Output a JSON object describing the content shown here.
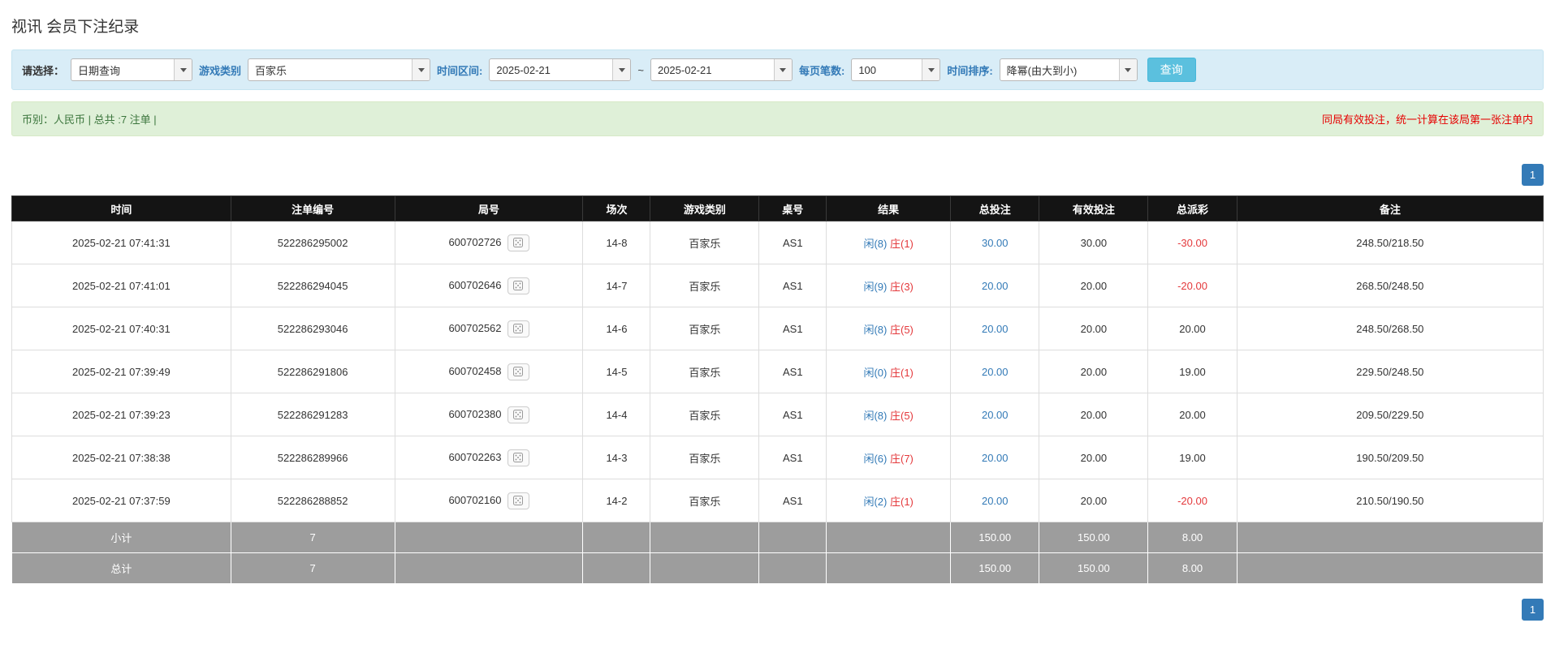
{
  "page": {
    "title": "视讯 会员下注纪录"
  },
  "filter_bar": {
    "select_label": "请选择：",
    "select_value": "日期查询",
    "game_label": "游戏类别",
    "game_value": "百家乐",
    "range_label": "时间区间:",
    "date_from": "2025-02-21",
    "range_separator": "~",
    "date_to": "2025-02-21",
    "page_size_label": "每页笔数:",
    "page_size_value": "100",
    "sort_label": "时间排序:",
    "sort_value": "降幂(由大到小)",
    "search_button": "查询"
  },
  "summary_bar": {
    "left_text": "币别：人民币 | 总共 :7 注单 |",
    "right_notice": "同局有效投注，统一计算在该局第一张注单内"
  },
  "pagination": {
    "current_page": "1"
  },
  "colors": {
    "accent_blue": "#337ab7",
    "search_button_blue": "#5bc0de",
    "filter_bar_bg": "#d9edf7",
    "summary_bar_bg": "#dff0d8",
    "header_bg": "#141414",
    "footer_bg": "#9d9d9d",
    "player_blue": "#337ab7",
    "banker_red": "#e4393c",
    "negative_red": "#e4393c",
    "notice_red": "#e60000"
  },
  "table": {
    "headers": [
      "时间",
      "注单编号",
      "局号",
      "场次",
      "游戏类别",
      "桌号",
      "结果",
      "总投注",
      "有效投注",
      "总派彩",
      "备注"
    ],
    "rows": [
      {
        "time": "2025-02-21 07:41:31",
        "bet_id": "522286295002",
        "round_id": "600702726",
        "session": "14-8",
        "game_type": "百家乐",
        "table_no": "AS1",
        "result_player": "闲(8)",
        "result_banker": "庄(1)",
        "total_bet": "30.00",
        "valid_bet": "30.00",
        "payout": "-30.00",
        "note": "248.50/218.50"
      },
      {
        "time": "2025-02-21 07:41:01",
        "bet_id": "522286294045",
        "round_id": "600702646",
        "session": "14-7",
        "game_type": "百家乐",
        "table_no": "AS1",
        "result_player": "闲(9)",
        "result_banker": "庄(3)",
        "total_bet": "20.00",
        "valid_bet": "20.00",
        "payout": "-20.00",
        "note": "268.50/248.50"
      },
      {
        "time": "2025-02-21 07:40:31",
        "bet_id": "522286293046",
        "round_id": "600702562",
        "session": "14-6",
        "game_type": "百家乐",
        "table_no": "AS1",
        "result_player": "闲(8)",
        "result_banker": "庄(5)",
        "total_bet": "20.00",
        "valid_bet": "20.00",
        "payout": "20.00",
        "note": "248.50/268.50"
      },
      {
        "time": "2025-02-21 07:39:49",
        "bet_id": "522286291806",
        "round_id": "600702458",
        "session": "14-5",
        "game_type": "百家乐",
        "table_no": "AS1",
        "result_player": "闲(0)",
        "result_banker": "庄(1)",
        "total_bet": "20.00",
        "valid_bet": "20.00",
        "payout": "19.00",
        "note": "229.50/248.50"
      },
      {
        "time": "2025-02-21 07:39:23",
        "bet_id": "522286291283",
        "round_id": "600702380",
        "session": "14-4",
        "game_type": "百家乐",
        "table_no": "AS1",
        "result_player": "闲(8)",
        "result_banker": "庄(5)",
        "total_bet": "20.00",
        "valid_bet": "20.00",
        "payout": "20.00",
        "note": "209.50/229.50"
      },
      {
        "time": "2025-02-21 07:38:38",
        "bet_id": "522286289966",
        "round_id": "600702263",
        "session": "14-3",
        "game_type": "百家乐",
        "table_no": "AS1",
        "result_player": "闲(6)",
        "result_banker": "庄(7)",
        "total_bet": "20.00",
        "valid_bet": "20.00",
        "payout": "19.00",
        "note": "190.50/209.50"
      },
      {
        "time": "2025-02-21 07:37:59",
        "bet_id": "522286288852",
        "round_id": "600702160",
        "session": "14-2",
        "game_type": "百家乐",
        "table_no": "AS1",
        "result_player": "闲(2)",
        "result_banker": "庄(1)",
        "total_bet": "20.00",
        "valid_bet": "20.00",
        "payout": "-20.00",
        "note": "210.50/190.50"
      }
    ],
    "footer_rows": [
      {
        "label": "小计",
        "cells": [
          "小计",
          "7",
          "",
          "",
          "",
          "",
          "",
          "150.00",
          "150.00",
          "8.00",
          ""
        ]
      },
      {
        "label": "总计",
        "cells": [
          "总计",
          "7",
          "",
          "",
          "",
          "",
          "",
          "150.00",
          "150.00",
          "8.00",
          ""
        ]
      }
    ]
  }
}
